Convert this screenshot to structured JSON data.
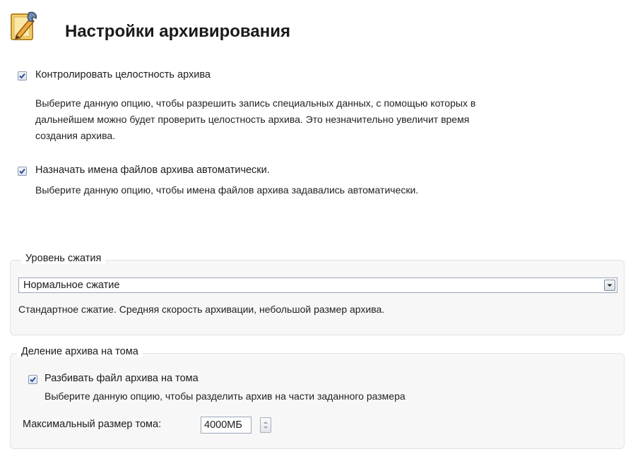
{
  "header": {
    "icon": "settings-pencil-wrench-icon",
    "title": "Настройки архивирования"
  },
  "integrity": {
    "checked": true,
    "label": "Контролировать целостность архива",
    "desc_lines": [
      "Выберите данную опцию, чтобы разрешить запись специальных данных, с помощью которых в",
      "дальнейшем можно будет проверить целостность архива. Это незначительно увеличит время",
      "создания архива."
    ]
  },
  "autonames": {
    "checked": true,
    "label": "Назначать имена файлов архива автоматически.",
    "desc": "Выберите данную опцию, чтобы имена файлов архива задавались автоматически."
  },
  "compression": {
    "group_title": "Уровень сжатия",
    "selected": "Нормальное сжатие",
    "desc": "Стандартное сжатие. Средняя скорость архивации, небольшой размер архива."
  },
  "split": {
    "group_title": "Деление архива на тома",
    "checked": true,
    "label": "Разбивать файл архива на тома",
    "desc": "Выберите данную опцию, чтобы разделить архив на части заданного размера",
    "max_size_label": "Максимальный размер тома:",
    "max_size_value": "4000МБ"
  },
  "colors": {
    "check": "#2b4f9e",
    "group_bg": "#f7f7f7"
  }
}
